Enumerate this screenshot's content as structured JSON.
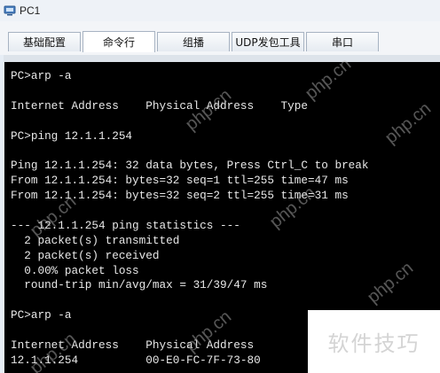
{
  "window": {
    "title": "PC1"
  },
  "tabs": [
    {
      "label": "基础配置"
    },
    {
      "label": "命令行"
    },
    {
      "label": "组播"
    },
    {
      "label": "UDP发包工具"
    },
    {
      "label": "串口"
    }
  ],
  "active_tab": "命令行",
  "terminal": {
    "lines": [
      "PC>arp -a",
      "",
      "Internet Address    Physical Address    Type",
      "",
      "PC>ping 12.1.1.254",
      "",
      "Ping 12.1.1.254: 32 data bytes, Press Ctrl_C to break",
      "From 12.1.1.254: bytes=32 seq=1 ttl=255 time=47 ms",
      "From 12.1.1.254: bytes=32 seq=2 ttl=255 time=31 ms",
      "",
      "--- 12.1.1.254 ping statistics ---",
      "  2 packet(s) transmitted",
      "  2 packet(s) received",
      "  0.00% packet loss",
      "  round-trip min/avg/max = 31/39/47 ms",
      "",
      "PC>arp -a",
      "",
      "Internet Address    Physical Address",
      "12.1.1.254          00-E0-FC-7F-73-80"
    ]
  },
  "overlay": {
    "text": "软件技巧"
  },
  "watermark": {
    "text": "php.cn"
  }
}
